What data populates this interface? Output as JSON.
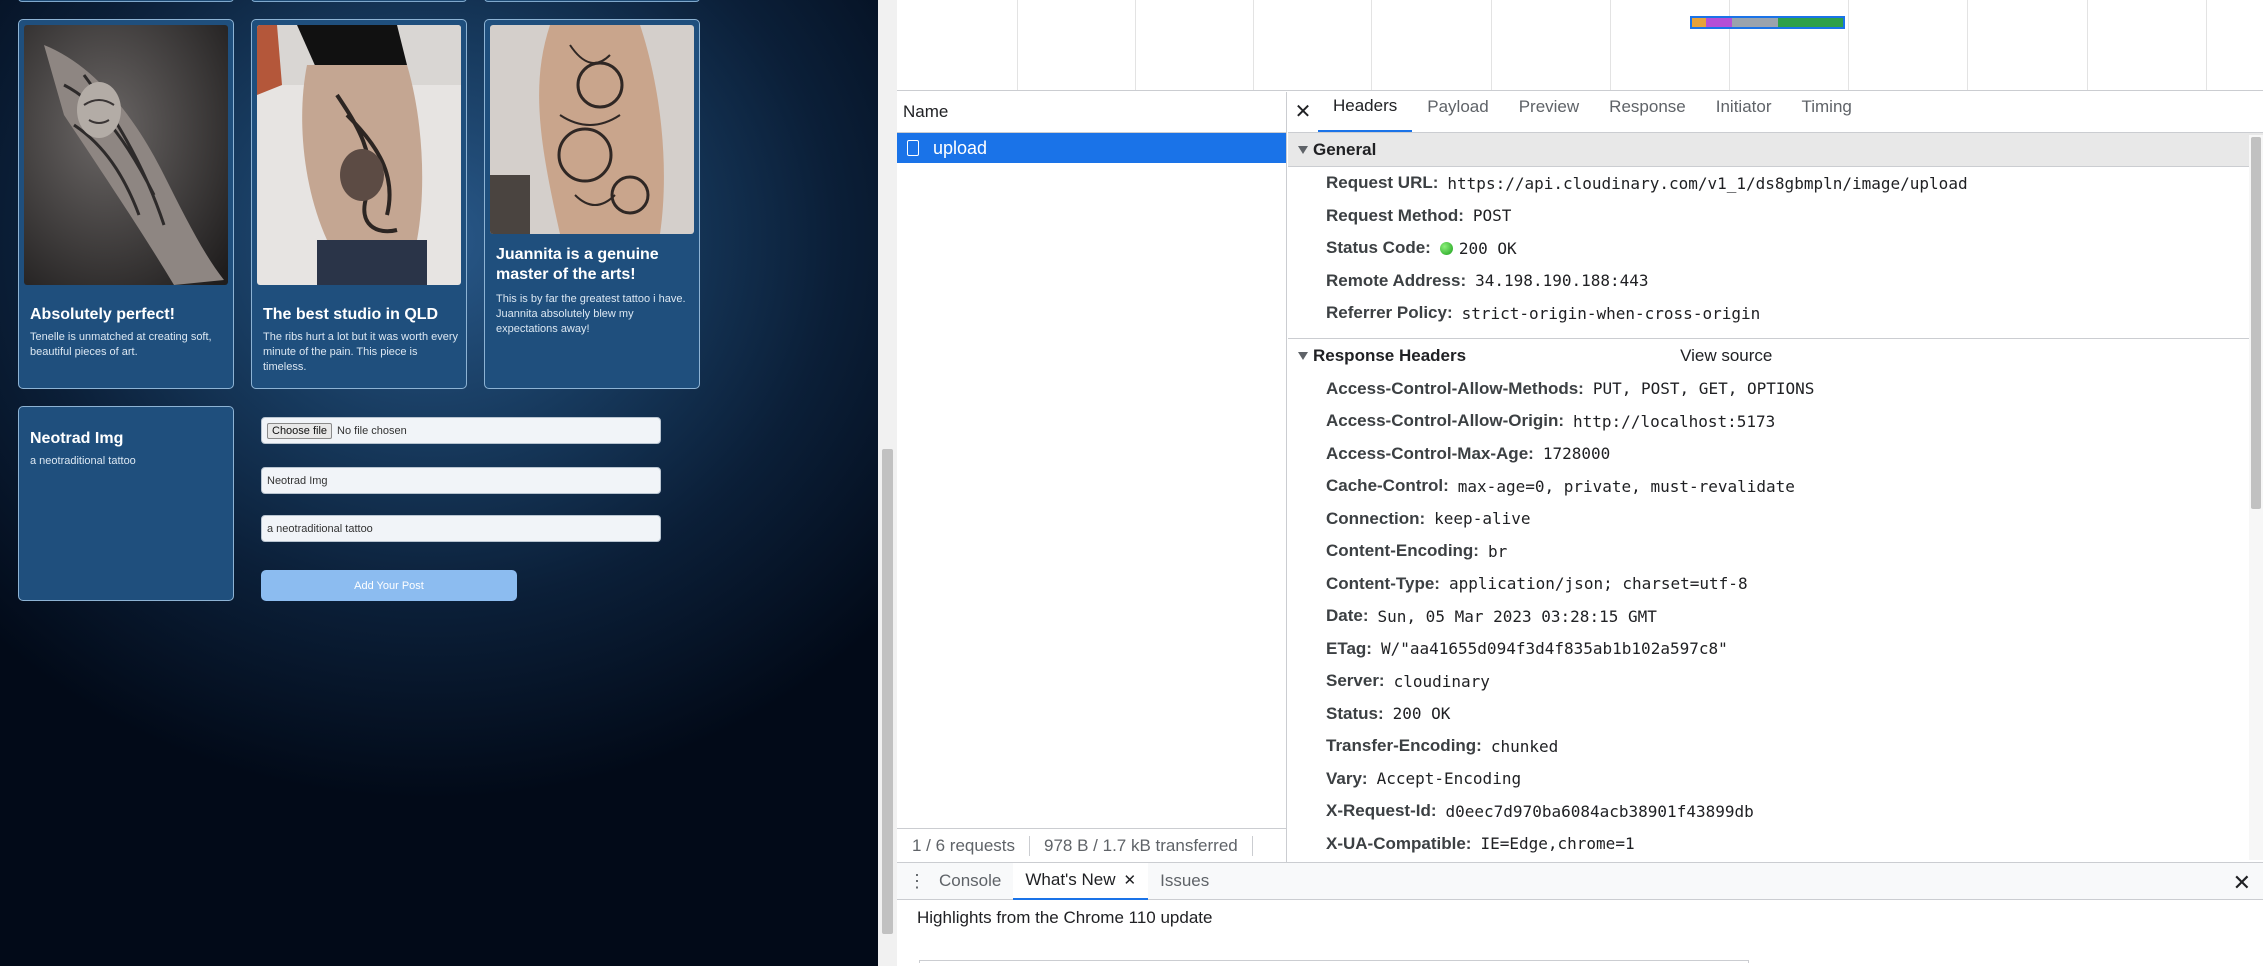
{
  "app": {
    "cards": [
      {
        "title": "Absolutely perfect!",
        "text": "Tenelle is unmatched at creating soft, beautiful pieces of art."
      },
      {
        "title": "The best studio in QLD",
        "text": "The ribs hurt a lot but it was worth every minute of the pain. This piece is timeless."
      },
      {
        "title": "Juannita is a genuine master of the arts!",
        "text": "This is by far the greatest tattoo i have. Juannita absolutely blew my expectations away!"
      }
    ],
    "preview_card": {
      "title": "Neotrad Img",
      "text": "a neotraditional tattoo"
    },
    "form": {
      "choose_file_label": "Choose file",
      "file_status": "No file chosen",
      "title_value": "Neotrad Img",
      "description_value": "a neotraditional tattoo",
      "submit_label": "Add Your Post"
    }
  },
  "devtools": {
    "names_header": "Name",
    "request_name": "upload",
    "status_bar": {
      "requests": "1 / 6 requests",
      "transferred": "978 B / 1.7 kB transferred"
    },
    "tabs": [
      "Headers",
      "Payload",
      "Preview",
      "Response",
      "Initiator",
      "Timing"
    ],
    "active_tab": "Headers",
    "general": {
      "title": "General",
      "rows": [
        {
          "key": "Request URL:",
          "value": "https://api.cloudinary.com/v1_1/ds8gbmpln/image/upload"
        },
        {
          "key": "Request Method:",
          "value": "POST"
        },
        {
          "key": "Status Code:",
          "value": "200 OK"
        },
        {
          "key": "Remote Address:",
          "value": "34.198.190.188:443"
        },
        {
          "key": "Referrer Policy:",
          "value": "strict-origin-when-cross-origin"
        }
      ]
    },
    "response_headers": {
      "title": "Response Headers",
      "view_source": "View source",
      "rows": [
        {
          "key": "Access-Control-Allow-Methods:",
          "value": "PUT, POST, GET, OPTIONS"
        },
        {
          "key": "Access-Control-Allow-Origin:",
          "value": "http://localhost:5173"
        },
        {
          "key": "Access-Control-Max-Age:",
          "value": "1728000"
        },
        {
          "key": "Cache-Control:",
          "value": "max-age=0, private, must-revalidate"
        },
        {
          "key": "Connection:",
          "value": "keep-alive"
        },
        {
          "key": "Content-Encoding:",
          "value": "br"
        },
        {
          "key": "Content-Type:",
          "value": "application/json; charset=utf-8"
        },
        {
          "key": "Date:",
          "value": "Sun, 05 Mar 2023 03:28:15 GMT"
        },
        {
          "key": "ETag:",
          "value": "W/\"aa41655d094f3d4f835ab1b102a597c8\""
        },
        {
          "key": "Server:",
          "value": "cloudinary"
        },
        {
          "key": "Status:",
          "value": "200 OK"
        },
        {
          "key": "Transfer-Encoding:",
          "value": "chunked"
        },
        {
          "key": "Vary:",
          "value": "Accept-Encoding"
        },
        {
          "key": "X-Request-Id:",
          "value": "d0eec7d970ba6084acb38901f43899db"
        },
        {
          "key": "X-UA-Compatible:",
          "value": "IE=Edge,chrome=1"
        }
      ]
    },
    "drawer": {
      "tabs": [
        "Console",
        "What's New",
        "Issues"
      ],
      "active_tab": "What's New",
      "body_text": "Highlights from the Chrome 110 update"
    },
    "colors": {
      "accent": "#1a73e8",
      "status_ok": "#1b9e1b"
    }
  }
}
